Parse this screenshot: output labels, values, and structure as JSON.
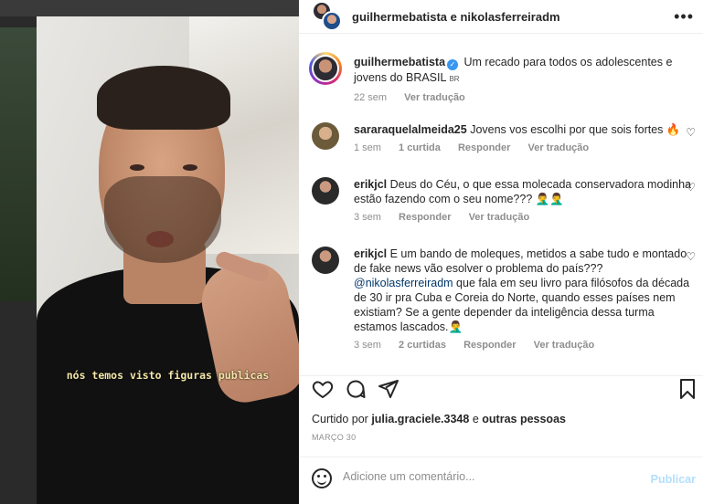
{
  "header": {
    "title": "guilhermebatista e nikolasferreiradm",
    "more_icon": "more-horizontal-icon"
  },
  "video": {
    "caption": "nós temos visto figuras publicas"
  },
  "caption_post": {
    "username": "guilhermebatista",
    "text": "Um recado para todos os adolescentes e jovens do BRASIL",
    "flag": "BR",
    "time": "22 sem",
    "reply_label": "Ver tradução"
  },
  "comments": [
    {
      "username": "sararaquelalmeida25",
      "text": "Jovens vos escolhi por que sois fortes 🔥",
      "time": "1 sem",
      "likes": "1 curtida",
      "reply": "Responder",
      "translate": "Ver tradução"
    },
    {
      "username": "erikjcl",
      "text": "Deus do Céu, o que essa molecada conservadora modinha estão fazendo com o seu nome??? 🤦‍♂️🤦‍♂️",
      "time": "3 sem",
      "reply": "Responder",
      "translate": "Ver tradução"
    },
    {
      "username": "erikjcl",
      "text_a": "E um bando de moleques, metidos a sabe tudo e montado de fake news vão esolver o problema do país???",
      "mention": "@nikolasferreiradm",
      "text_b": "que fala em seu livro para filósofos da década de 30 ir pra Cuba e Coreia do Norte, quando esses países nem existiam? Se a gente depender da inteligência dessa turma estamos lascados.🤦‍♂️",
      "time": "3 sem",
      "likes": "2 curtidas",
      "reply": "Responder",
      "translate": "Ver tradução"
    }
  ],
  "likes_line": {
    "prefix": "Curtido por",
    "user": "julia.graciele.3348",
    "joiner": "e",
    "others": "outras pessoas"
  },
  "date": "MARÇO 30",
  "add_comment": {
    "placeholder": "Adicione um comentário...",
    "publish": "Publicar"
  },
  "colors": {
    "verified": "#3897f0",
    "link": "#00376b",
    "publish_disabled": "#b2dffc",
    "caption_yellow": "#f3e7a8"
  }
}
